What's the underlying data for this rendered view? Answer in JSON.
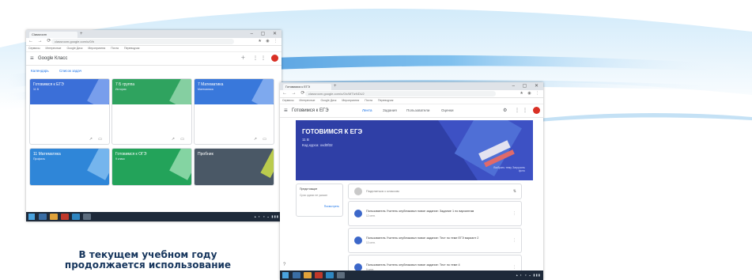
{
  "colors": {
    "slide_background": "#ffffff",
    "swoosh_blue": "#5aa9e6",
    "caption_text": "#17365d",
    "classroom_blue": "#1a73e8",
    "card_banners": [
      "#3b6fd8",
      "#2fa35f",
      "#3978db",
      "#2f86d8",
      "#23a35a",
      "#4a5866"
    ],
    "hero_banner": "#2f3fa6",
    "avatar": "#d93025"
  },
  "caption": {
    "line1": "В текущем учебном году",
    "line2": "продолжается использование"
  },
  "screenshot_left": {
    "tab_label": "Classroom",
    "address": "classroom.google.com/u/0/h",
    "bookmarks": [
      "Сервисы",
      "Интересные",
      "Google Диск",
      "Мероприятия",
      "Почта",
      "Переводчик"
    ],
    "app_title": "Google Класс",
    "subbar": {
      "calendar": "Календарь",
      "todo": "Список задач"
    },
    "courses": [
      {
        "title": "Готовимся к ЕГЭ",
        "subtitle": "11 В"
      },
      {
        "title": "7 Б группа",
        "subtitle": "История"
      },
      {
        "title": "7 Математика",
        "subtitle": "Математика"
      },
      {
        "title": "11 Математика",
        "subtitle": "Профиль"
      },
      {
        "title": "Готовимся к ОГЭ",
        "subtitle": "9 класс"
      },
      {
        "title": "Пробник",
        "subtitle": ""
      }
    ],
    "icons": {
      "menu": "menu-icon",
      "apps": "apps-icon",
      "add": "plus-icon",
      "help": "help-icon"
    }
  },
  "screenshot_right": {
    "tab_label": "Готовимся к ЕГЭ",
    "address": "classroom.google.com/u/0/c/MTIzNDU2",
    "bookmarks": [
      "Сервисы",
      "Интересные",
      "Google Диск",
      "Мероприятия",
      "Почта",
      "Переводчик"
    ],
    "app_title": "Готовимся к ЕГЭ",
    "nav_tabs": [
      "Лента",
      "Задания",
      "Пользователи",
      "Оценки"
    ],
    "hero": {
      "title": "ГОТОВИМСЯ К ЕГЭ",
      "line1": "11 В",
      "line2": "Код курса: xvd0f32",
      "note": "Выбрать тему Загрузить фото"
    },
    "side": {
      "title": "Предстоящие",
      "empty": "Срок сдачи не указан",
      "link": "Посмотреть"
    },
    "share_prompt": "Поделиться с классом",
    "posts": [
      {
        "text": "Пользователь Учитель опубликовал новое задание: Задание 1 по вариантам",
        "date": "12 сент."
      },
      {
        "text": "Пользователь Учитель опубликовал новое задание: Тест по теме ЕГЭ вариант 2",
        "date": "10 сент."
      },
      {
        "text": "Пользователь Учитель опубликовал новое задание: Тест по теме 4",
        "date": "9 сент."
      }
    ]
  }
}
